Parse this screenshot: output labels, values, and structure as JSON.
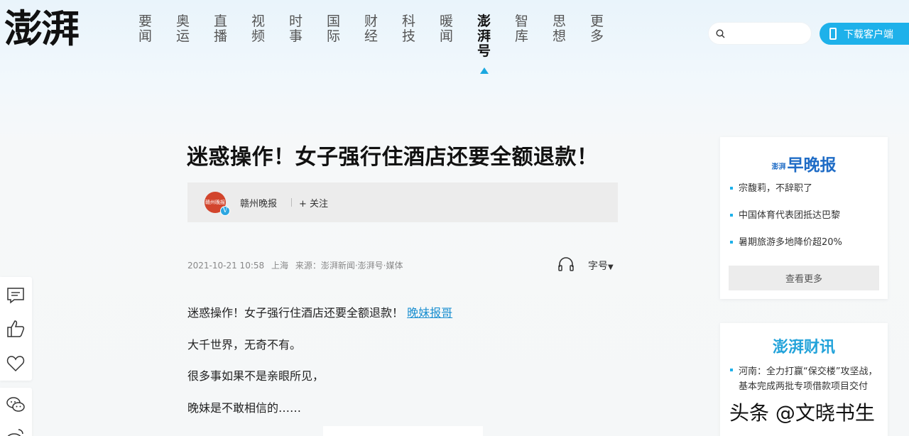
{
  "header": {
    "logo": "澎湃",
    "nav": [
      "要闻",
      "奥运",
      "直播",
      "视频",
      "时事",
      "国际",
      "财经",
      "科技",
      "暖闻",
      "澎湃号",
      "智库",
      "思想",
      "更多"
    ],
    "active_nav": "澎湃号",
    "search_placeholder": "",
    "download_label": "下载客户端"
  },
  "article": {
    "title": "迷惑操作！女子强行住酒店还要全额退款！",
    "author": {
      "avatar_text": "赣州晚报",
      "verified_glyph": "V",
      "name": "赣州晚报",
      "follow_label": "+ 关注"
    },
    "meta": {
      "date": "2021-10-21 10:58",
      "location": "上海",
      "source": "来源：澎湃新闻·澎湃号·媒体"
    },
    "font_size_label": "字号",
    "paragraphs": [
      {
        "text": "迷惑操作！女子强行住酒店还要全额退款！",
        "link": "晚妹报哥"
      },
      {
        "text": "大千世界，无奇不有。"
      },
      {
        "text": "很多事如果不是亲眼所见，"
      },
      {
        "text": "晚妹是不敢相信的……"
      }
    ]
  },
  "sidebar": {
    "card1": {
      "logo_small": "澎湃",
      "logo": "早晚报",
      "items": [
        "宗馥莉，不辞职了",
        "中国体育代表团抵达巴黎",
        "暑期旅游多地降价超20%"
      ],
      "more_label": "查看更多"
    },
    "card2": {
      "logo": "澎湃财讯",
      "items": [
        "河南：全力打赢“保交楼”攻坚战，基本完成两批专项借款项目交付"
      ]
    }
  },
  "watermark": "头条 @文晓书生",
  "colors": {
    "accent": "#1eb1ea",
    "link": "#1a8fd0",
    "nav_caret": "#1ba8e0"
  }
}
